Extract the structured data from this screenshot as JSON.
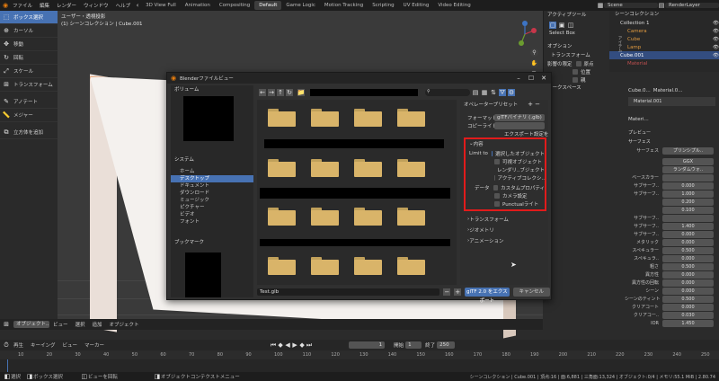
{
  "menubar": {
    "items": [
      "ファイル",
      "編集",
      "レンダー",
      "ウィンドウ",
      "ヘルプ"
    ],
    "workspace_tabs": [
      "3D View Full",
      "Animation",
      "Compositing",
      "Default",
      "Game Logic",
      "Motion Tracking",
      "Scripting",
      "UV Editing",
      "Video Editing"
    ],
    "active_tab": "Default",
    "scene": "Scene",
    "render_layer": "RenderLayer"
  },
  "viewport": {
    "info_line1": "ユーザー・透視投影",
    "info_line2": "(1) シーンコレクション | Cube.001"
  },
  "toolbar": {
    "items": [
      {
        "label": "ボックス選択",
        "icon": "select-box-icon",
        "active": true
      },
      {
        "label": "カーソル",
        "icon": "cursor-icon",
        "active": false
      },
      {
        "label": "移動",
        "icon": "move-icon",
        "active": false
      },
      {
        "label": "回転",
        "icon": "rotate-icon",
        "active": false
      },
      {
        "label": "スケール",
        "icon": "scale-icon",
        "active": false
      },
      {
        "label": "トランスフォーム",
        "icon": "transform-icon",
        "active": false
      },
      {
        "label": "アノテート",
        "icon": "annotate-icon",
        "active": false
      },
      {
        "label": "メジャー",
        "icon": "measure-icon",
        "active": false
      },
      {
        "label": "立方体を追加",
        "icon": "add-cube-icon",
        "active": false
      }
    ]
  },
  "active_tool_panel": {
    "title": "アクティブツール",
    "select_box": "Select Box",
    "options_title": "オプション",
    "transform": "トランスフォーム",
    "affect_only": "影響の限定",
    "origin": "原点",
    "location": "位置",
    "parent": "親",
    "workspace": "ワークスペース"
  },
  "dialog": {
    "title": "Blenderファイルビュー",
    "volumes": "ボリューム",
    "system": "システム",
    "system_items": [
      "ホーム",
      "デスクトップ",
      "ドキュメント",
      "ダウンロード",
      "ミュージック",
      "ピクチャー",
      "ビデオ",
      "フォント"
    ],
    "system_selected": "デスクトップ",
    "bookmarks": "ブックマーク",
    "operator_presets": "オペレータープリセット",
    "format_label": "フォーマット",
    "format_value": "glTFバイナリ (.glb)",
    "copyright_label": "コピーライト",
    "export_settings": "エクスポート設定を",
    "include_title": "内容",
    "limit_to": "Limit to",
    "selected_objects": "選択したオブジェクト",
    "visible_objects": "可視オブジェクト",
    "renderable_objects": "レンダリ..ブジェクト",
    "active_collection": "アクティブコレクシ..",
    "data_label": "データ",
    "custom_properties": "カスタムプロパティ",
    "cameras": "カメラ設定",
    "punctual_lights": "Punctualライト",
    "transform_section": "トランスフォーム",
    "geometry_section": "ジオメトリ",
    "animation_section": "アニメーション",
    "filename": "Test.glb",
    "export_button": "glTF 2.0 をエクスポート",
    "cancel_button": "キャンセル"
  },
  "outliner": {
    "title": "シーンコレクション",
    "items": [
      "Collection 1",
      "Camera",
      "Cube",
      "Lamp",
      "Cube.001",
      "Material"
    ]
  },
  "properties": {
    "object_name": "Cube.0...",
    "material_name": "Material.0...",
    "material_slot": "Material.001",
    "material_short": "Materi...",
    "preview": "プレビュー",
    "surface_section": "サーフェス",
    "surface_label": "サーフェス",
    "surface_value": "プリンシプル..",
    "ggx": "GGX",
    "random_walk": "ランダムウォ..",
    "rows": [
      {
        "label": "ベースカラー",
        "value": ""
      },
      {
        "label": "サブサーフ..",
        "value": "0.000"
      },
      {
        "label": "サブサーフ..",
        "value": "1.000"
      },
      {
        "label": "",
        "value": "0.200"
      },
      {
        "label": "",
        "value": "0.100"
      },
      {
        "label": "サブサーフ..",
        "value": ""
      },
      {
        "label": "サブサーフ..",
        "value": "1.400"
      },
      {
        "label": "サブサーフ..",
        "value": "0.000"
      },
      {
        "label": "メタリック",
        "value": "0.000"
      },
      {
        "label": "スペキュラー",
        "value": "0.500"
      },
      {
        "label": "スペキュラ..",
        "value": "0.000"
      },
      {
        "label": "粗さ",
        "value": "0.500"
      },
      {
        "label": "異方性",
        "value": "0.000"
      },
      {
        "label": "異方性の回転",
        "value": "0.000"
      },
      {
        "label": "シーン",
        "value": "0.000"
      },
      {
        "label": "シーンのティント",
        "value": "0.500"
      },
      {
        "label": "クリアコート",
        "value": "0.000"
      },
      {
        "label": "クリアコー..",
        "value": "0.030"
      },
      {
        "label": "IOR",
        "value": "1.450"
      }
    ],
    "side_tabs": [
      "アイテム",
      "ツール",
      "ビュー"
    ]
  },
  "viewport_header": {
    "mode": "オブジェクト..",
    "menus": [
      "ビュー",
      "選択",
      "追加",
      "オブジェクト"
    ]
  },
  "timeline": {
    "menus": [
      "再生",
      "キーイング",
      "ビュー",
      "マーカー"
    ],
    "current_frame": "1",
    "start_label": "開始",
    "start": "1",
    "end_label": "終了",
    "end": "250",
    "ticks": [
      "10",
      "20",
      "30",
      "40",
      "50",
      "60",
      "70",
      "80",
      "90",
      "100",
      "110",
      "120",
      "130",
      "140",
      "150",
      "160",
      "170",
      "180",
      "190",
      "200",
      "210",
      "220",
      "230",
      "240",
      "250"
    ]
  },
  "statusbar": {
    "select": "選択",
    "box_select": "ボックス選択",
    "rotate_view": "ビューを回転",
    "context_menu": "オブジェクトコンテクストメニュー",
    "stats": "シーンコレクション | Cube.001 | 頂点:16 | 面:6,881 | 三角面:13,324 | オブジェクト:0/4 | メモリ:55.1 MiB | 2.80.74"
  },
  "colors": {
    "accent": "#4772b3",
    "highlight_box": "#e11b1b",
    "folder": "#d9b469"
  }
}
